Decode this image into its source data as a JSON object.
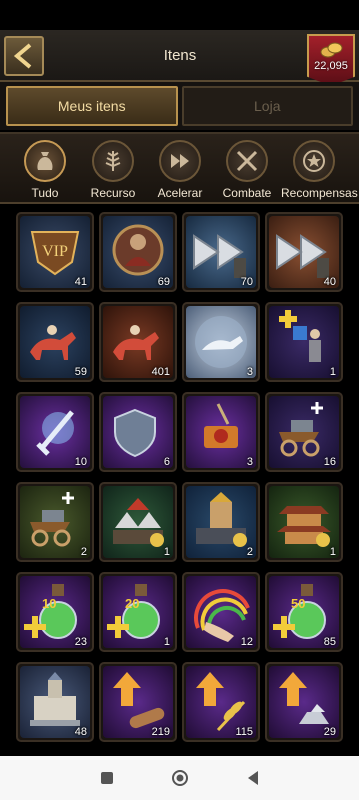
{
  "header": {
    "title": "Itens",
    "gold_amount": "22,095"
  },
  "tabs": [
    {
      "label": "Meus itens"
    },
    {
      "label": "Loja"
    }
  ],
  "categories": [
    {
      "label": "Tudo",
      "icon": "bag-icon"
    },
    {
      "label": "Recurso",
      "icon": "leaf-icon"
    },
    {
      "label": "Acelerar",
      "icon": "fast-forward-icon"
    },
    {
      "label": "Combate",
      "icon": "crossed-swords-icon"
    },
    {
      "label": "Recompensas",
      "icon": "star-medal-icon"
    }
  ],
  "items": [
    {
      "name": "vip",
      "count": "41"
    },
    {
      "name": "warrior-portrait",
      "count": "69"
    },
    {
      "name": "speedup-blue",
      "count": "70"
    },
    {
      "name": "speedup-copper",
      "count": "40"
    },
    {
      "name": "cavalry-red",
      "count": "59"
    },
    {
      "name": "cavalry-red-2",
      "count": "401"
    },
    {
      "name": "snow-cavalry",
      "count": "3"
    },
    {
      "name": "soldier-plus",
      "count": "1"
    },
    {
      "name": "glowing-sword",
      "count": "10"
    },
    {
      "name": "glowing-shield",
      "count": "6"
    },
    {
      "name": "seal-scroll",
      "count": "3"
    },
    {
      "name": "siege-cart-plus",
      "count": "16"
    },
    {
      "name": "siege-cart-plus-2",
      "count": "2"
    },
    {
      "name": "army-camp",
      "count": "1"
    },
    {
      "name": "fortress-army",
      "count": "2"
    },
    {
      "name": "pagoda",
      "count": "1"
    },
    {
      "name": "potion-10",
      "count": "23",
      "label": "10"
    },
    {
      "name": "potion-20",
      "count": "1",
      "label": "20"
    },
    {
      "name": "rainbow-hand",
      "count": "12"
    },
    {
      "name": "potion-50",
      "count": "85",
      "label": "50"
    },
    {
      "name": "castle",
      "count": "48"
    },
    {
      "name": "wood-boost",
      "count": "219"
    },
    {
      "name": "food-boost",
      "count": "115"
    },
    {
      "name": "stone-boost",
      "count": "29"
    }
  ],
  "colors": {
    "accent_gold": "#c79c4e",
    "badge_red": "#a3202a"
  }
}
